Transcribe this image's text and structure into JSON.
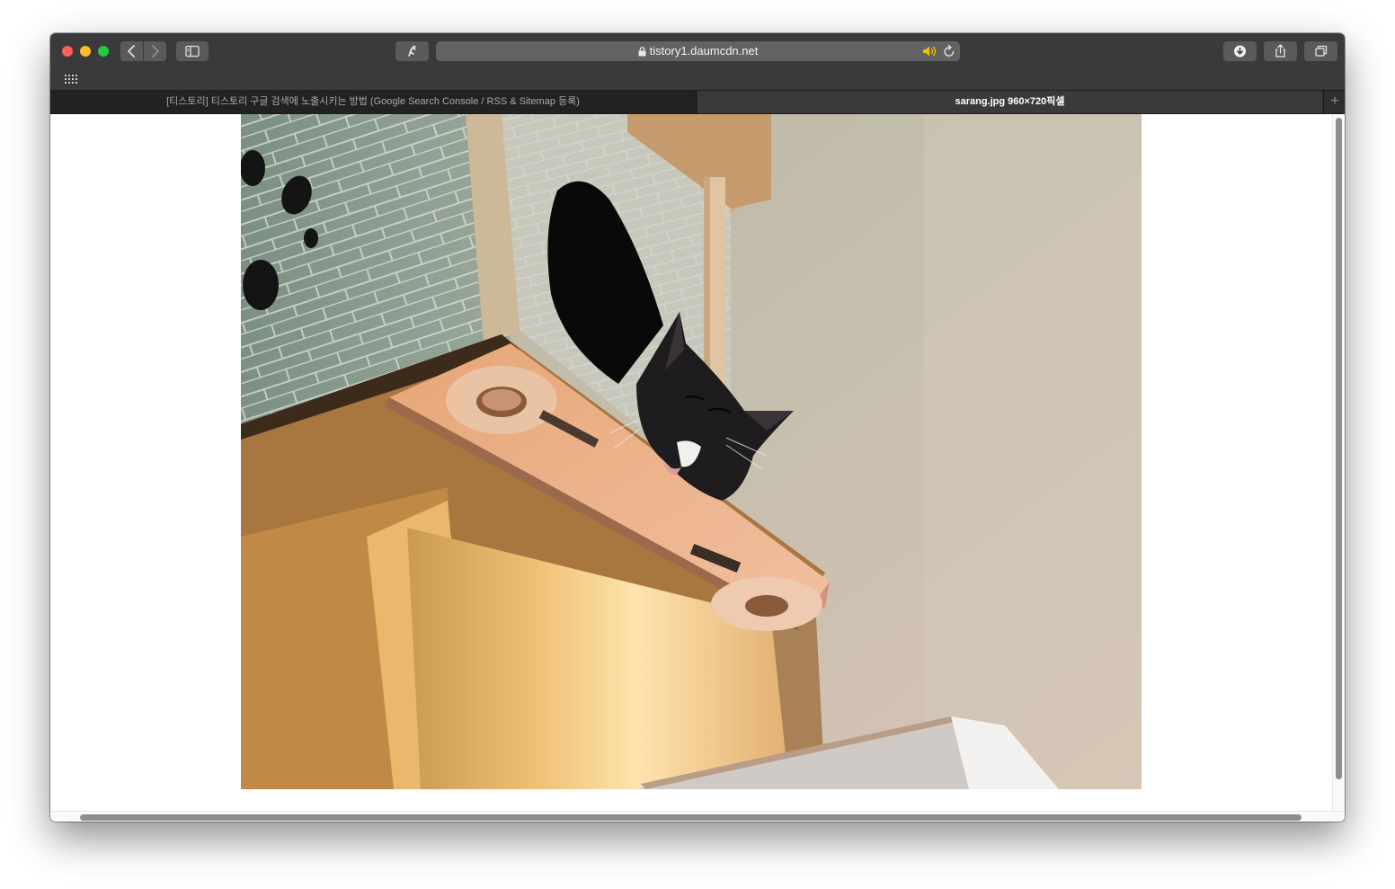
{
  "window": {
    "controls": [
      "close",
      "minimize",
      "zoom"
    ]
  },
  "toolbar": {
    "back_icon": "chevron-left-icon",
    "forward_icon": "chevron-right-icon",
    "sidebar_icon": "sidebar-icon",
    "extension_icon": "extension-icon",
    "download_icon": "download-icon",
    "share_icon": "share-icon",
    "tabs_icon": "tab-overview-icon"
  },
  "address": {
    "url": "tistory1.daumcdn.net",
    "secure_icon": "lock-icon",
    "audio_icon": "speaker-icon",
    "reload_icon": "reload-icon"
  },
  "favorites": {
    "grid_icon": "favorites-grid-icon"
  },
  "tabs": [
    {
      "title": "[티스토리] 티스토리 구글 검색에 노출시키는 방법 (Google Search Console / RSS & Sitemap 등록)",
      "active": false
    },
    {
      "title": "sarang.jpg 960×720픽셀",
      "active": true
    }
  ],
  "new_tab_label": "+",
  "content": {
    "image_subject": "cat sleeping in cardboard cat house",
    "background": "#ffffff"
  },
  "colors": {
    "toolbar": "#3a3a3c",
    "close": "#fe5f57",
    "minimize": "#febc2e",
    "zoom": "#28c840",
    "speaker_accent": "#f5c400"
  }
}
